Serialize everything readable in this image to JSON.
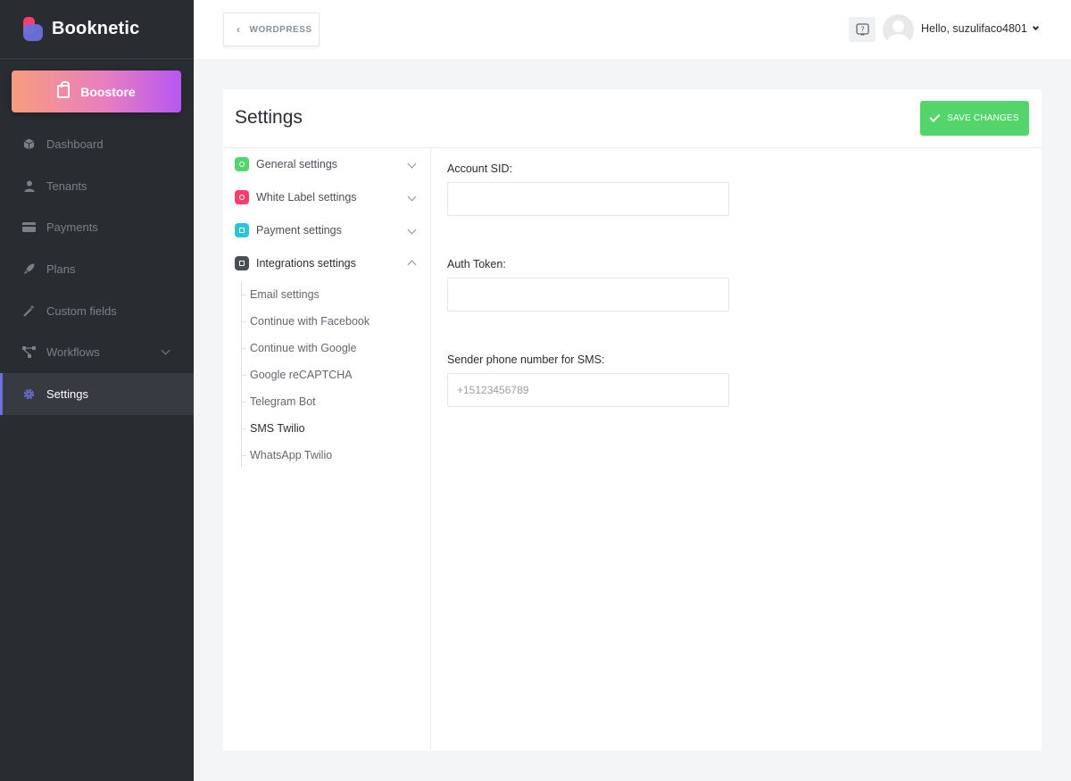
{
  "brand": {
    "name": "Booknetic"
  },
  "boostore": {
    "label": "Boostore"
  },
  "sidebar": {
    "items": [
      {
        "label": "Dashboard",
        "icon": "cube-icon"
      },
      {
        "label": "Tenants",
        "icon": "user-icon"
      },
      {
        "label": "Payments",
        "icon": "credit-card-icon"
      },
      {
        "label": "Plans",
        "icon": "rocket-icon"
      },
      {
        "label": "Custom fields",
        "icon": "magic-wand-icon"
      },
      {
        "label": "Workflows",
        "icon": "workflow-icon"
      },
      {
        "label": "Settings",
        "icon": "gear-icon"
      }
    ],
    "active": "Settings"
  },
  "topbar": {
    "back_label": "WORDPRESS",
    "greeting": "Hello, suzulifaco4801"
  },
  "page": {
    "title": "Settings",
    "save_label": "SAVE CHANGES"
  },
  "settings_nav": {
    "groups": [
      {
        "label": "General settings",
        "color": "#53d56c"
      },
      {
        "label": "White Label settings",
        "color": "#fb3e6e"
      },
      {
        "label": "Payment settings",
        "color": "#2bc4d9"
      },
      {
        "label": "Integrations settings",
        "color": "#4a4f57"
      }
    ],
    "integrations": [
      "Email settings",
      "Continue with Facebook",
      "Continue with Google",
      "Google reCAPTCHA",
      "Telegram Bot",
      "SMS Twilio",
      "WhatsApp Twilio"
    ],
    "active_sub": "SMS Twilio"
  },
  "form": {
    "account_sid": {
      "label": "Account SID:",
      "value": ""
    },
    "auth_token": {
      "label": "Auth Token:",
      "value": ""
    },
    "sender_phone": {
      "label": "Sender phone number for SMS:",
      "placeholder": "+15123456789",
      "value": ""
    }
  },
  "colors": {
    "sidebar_bg": "#292d32",
    "accent": "#6c70dc",
    "save_green": "#53d56c"
  }
}
